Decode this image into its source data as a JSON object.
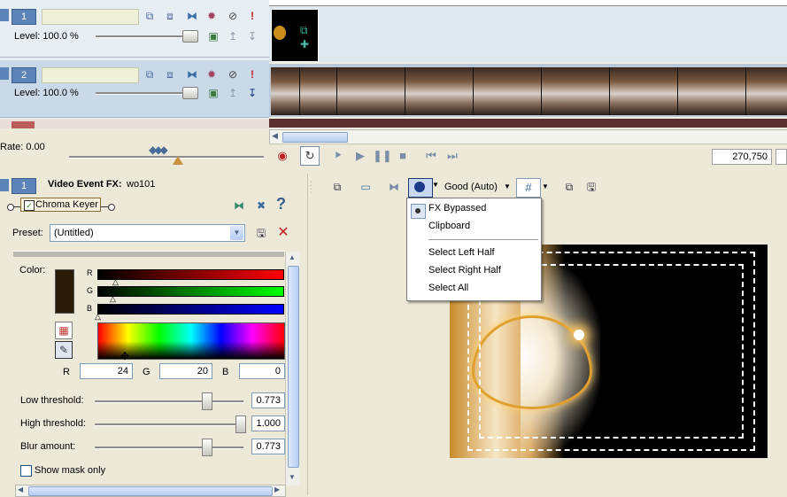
{
  "tracks": [
    {
      "number": "1",
      "level_label": "Level: 100.0 %"
    },
    {
      "number": "2",
      "level_label": "Level: 100.0 %"
    }
  ],
  "rate_label": "Rate: 0.00",
  "transport": {
    "timecode": "270,750"
  },
  "fx_panel": {
    "track_number": "1",
    "title": "Video Event FX:",
    "event_name": "wo101",
    "plugin_name": "Chroma Keyer",
    "preset_label": "Preset:",
    "preset_value": "(Untitled)",
    "color_label": "Color:",
    "channel_r": "R",
    "channel_g": "G",
    "channel_b": "B",
    "r_value": "24",
    "g_value": "20",
    "b_value": "0",
    "low_threshold_label": "Low threshold:",
    "low_threshold_value": "0.773",
    "high_threshold_label": "High threshold:",
    "high_threshold_value": "1.000",
    "blur_label": "Blur amount:",
    "blur_value": "0.773",
    "show_mask_label": "Show mask only",
    "swatch_color": "#2a1a08"
  },
  "preview_toolbar": {
    "quality": "Good (Auto)"
  },
  "split_menu": {
    "items": [
      "FX Bypassed",
      "Clipboard",
      "Select Left Half",
      "Select Right Half",
      "Select All"
    ]
  },
  "colors": {
    "accent": "#5c84b8",
    "track2_bg": "#c9d9e8",
    "menu_border": "#7a7a7a"
  }
}
